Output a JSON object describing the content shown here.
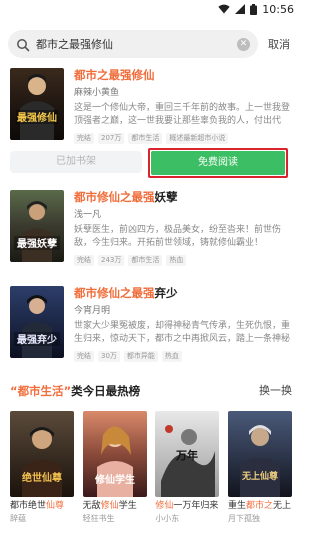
{
  "status": {
    "time": "10:56"
  },
  "search": {
    "query": "都市之最强修仙",
    "cancel": "取消"
  },
  "results": [
    {
      "title_hl": "都市之最强修仙",
      "title_rest": "",
      "author": "麻辣小黄鱼",
      "desc": "这是一个修仙大帝，重回三千年前的故事。上一世我登顶强者之巅，这一世我要让那些辜负我的人，付出代价。",
      "tags": [
        "完结",
        "207万",
        "都市生活",
        "概述最新超市小说"
      ],
      "cover_text": "最强修仙"
    },
    {
      "title_hl": "都市修仙之最强",
      "title_rest": "妖孽",
      "author": "浅一凡",
      "desc": "妖孽医生，前凶四方，极品美女，纷至沓来！前世伤敌，今生归来。开拓前世领域，铸就修仙霸业！",
      "tags": [
        "完结",
        "243万",
        "都市生活",
        "热血"
      ],
      "cover_text": "最强妖孽"
    },
    {
      "title_hl": "都市修仙之最强",
      "title_rest": "弃少",
      "author": "今宵月明",
      "desc": "世家大少果冤被废，却得神秘青气传承，生死仇恨，重生归来，惊动天下，都市之中再掀风云，踏上一条神秘的修行之路！",
      "tags": [
        "完结",
        "30万",
        "都市异能",
        "热血"
      ],
      "cover_text": "最强弃少"
    }
  ],
  "actions": {
    "shelf": "已加书架",
    "read": "免费阅读"
  },
  "hot": {
    "quote_open": "“",
    "category": "都市生活",
    "quote_close": "”",
    "title_suffix": "类今日最热榜",
    "refresh": "换一换",
    "items": [
      {
        "name_a": "都市绝世",
        "name_hl": "仙尊",
        "name_b": "",
        "author": "辞蕴",
        "cover_text": "绝世仙尊"
      },
      {
        "name_a": "无敌",
        "name_hl": "修仙",
        "name_b": "学生",
        "author": "轻狂书生",
        "cover_text": "修仙学生"
      },
      {
        "name_a": "",
        "name_hl": "修仙",
        "name_b": "一万年归来",
        "author": "小小东",
        "cover_text": "万年"
      },
      {
        "name_a": "重生",
        "name_hl": "都市之",
        "name_b": "无上",
        "author": "月下孤独",
        "cover_text": "无上仙尊"
      }
    ]
  },
  "colors": {
    "accent": "#f06e3c",
    "read_button": "#3cbf64",
    "highlight_border": "#d9232d"
  }
}
